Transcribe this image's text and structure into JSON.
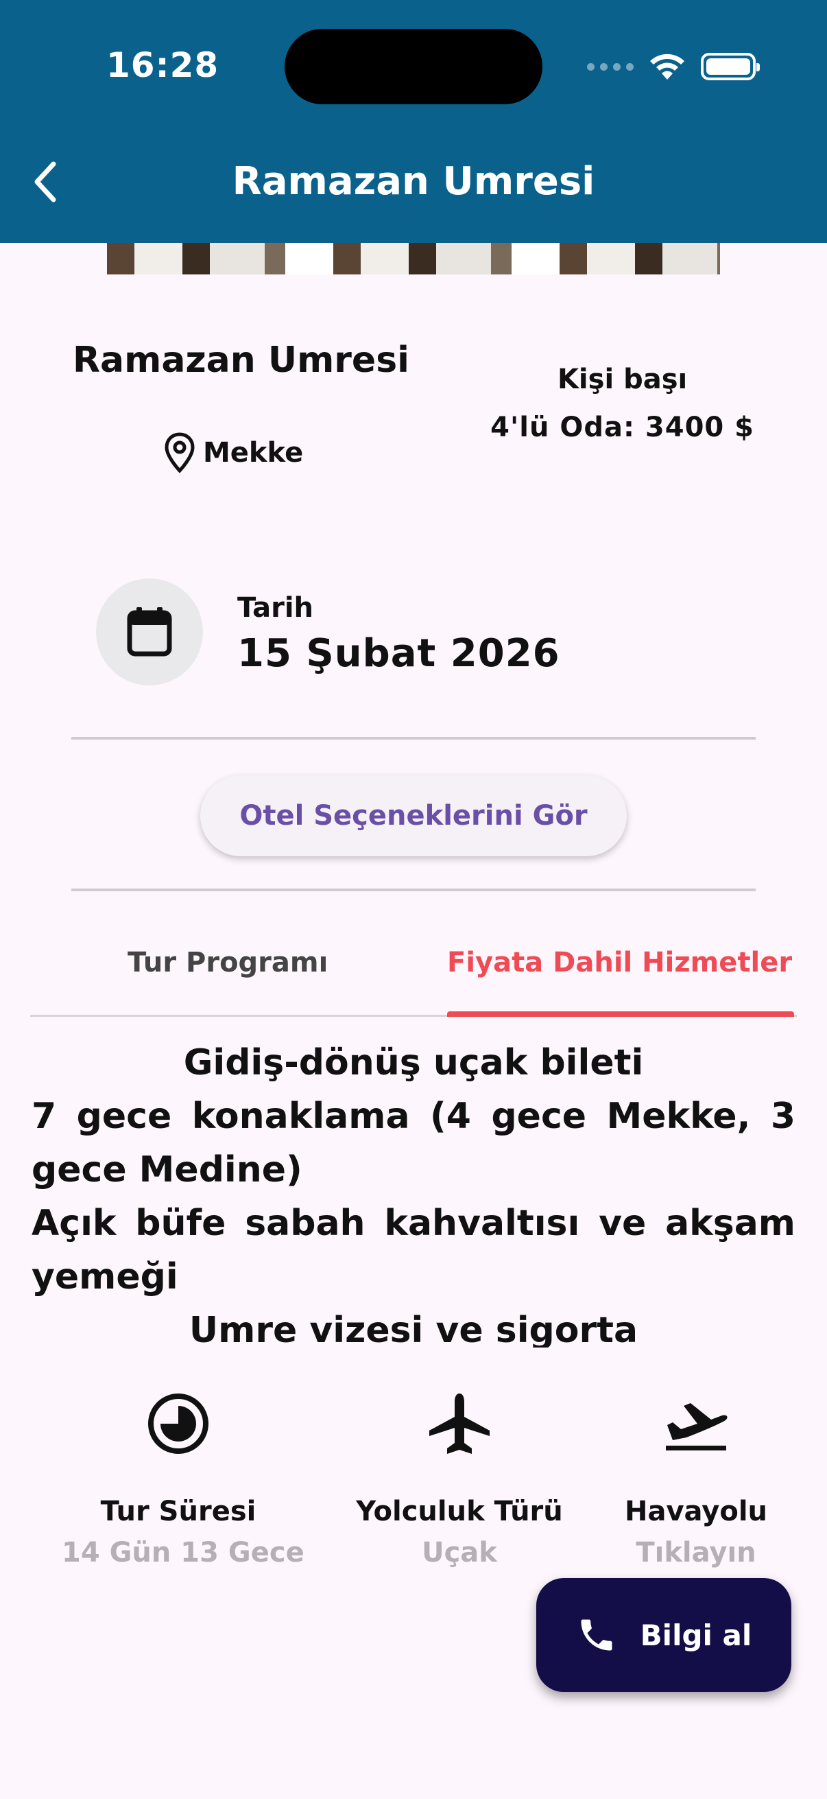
{
  "status_bar": {
    "time": "16:28"
  },
  "header": {
    "title": "Ramazan Umresi"
  },
  "package": {
    "title": "Ramazan Umresi",
    "location": "Mekke",
    "price_per_person": "Kişi başı",
    "price_line": "4'lü Oda: 3400 $"
  },
  "date": {
    "label": "Tarih",
    "value": "15 Şubat 2026"
  },
  "hotel_button": {
    "label": "Otel Seçeneklerini Gör"
  },
  "tabs": [
    {
      "label": "Tur Programı",
      "selected": false
    },
    {
      "label": "Fiyata Dahil Hizmetler",
      "selected": true
    }
  ],
  "services": [
    "Gidiş-dönüş uçak bileti",
    "7 gece konaklama (4 gece Mekke, 3 gece Medine)",
    "Açık büfe sabah kahvaltısı ve akşam yemeği",
    "Umre vizesi ve sigorta"
  ],
  "info": [
    {
      "icon": "clock-icon",
      "label": "Tur Süresi",
      "value": "14 Gün 13 Gece"
    },
    {
      "icon": "airplane-icon",
      "label": "Yolculuk Türü",
      "value": "Uçak"
    },
    {
      "icon": "flight-takeoff-icon",
      "label": "Havayolu",
      "value": "Tıklayın"
    }
  ],
  "contact_button": {
    "label": "Bilgi al",
    "icon": "phone-icon"
  },
  "colors": {
    "header_bg": "#0a628c",
    "accent_tab": "#ef4b55",
    "button_text": "#6a4fa6",
    "fab_bg": "#140e48",
    "background": "#fdf6fc"
  }
}
